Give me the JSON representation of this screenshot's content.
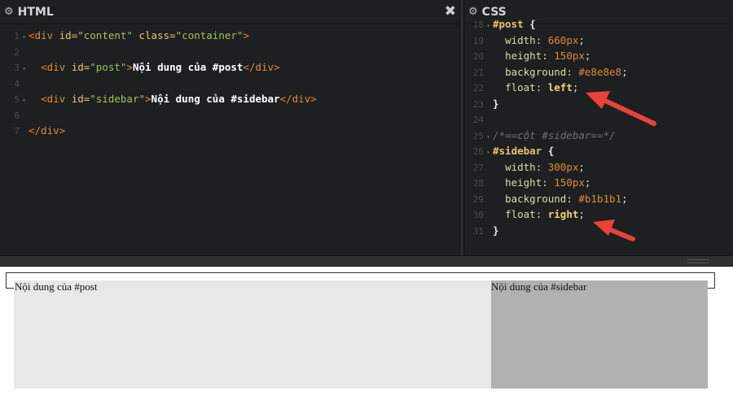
{
  "html_panel": {
    "title": "HTML",
    "settings_icon": "gear-icon",
    "close_icon": "close-icon",
    "lines": [
      {
        "n": "1",
        "fold": true,
        "parts": [
          [
            "tag",
            "<div "
          ],
          [
            "attr",
            "id="
          ],
          [
            "str",
            "\"content\""
          ],
          [
            "attr",
            " class="
          ],
          [
            "str",
            "\"container\""
          ],
          [
            "tag",
            ">"
          ]
        ]
      },
      {
        "n": "2",
        "fold": false,
        "parts": []
      },
      {
        "n": "3",
        "fold": true,
        "parts": [
          [
            "plain",
            "  "
          ],
          [
            "tag",
            "<div "
          ],
          [
            "attr",
            "id="
          ],
          [
            "str",
            "\"post\""
          ],
          [
            "tag",
            ">"
          ],
          [
            "txt",
            "Nội dung của #post"
          ],
          [
            "tag",
            "</div>"
          ]
        ]
      },
      {
        "n": "4",
        "fold": false,
        "parts": []
      },
      {
        "n": "5",
        "fold": true,
        "parts": [
          [
            "plain",
            "  "
          ],
          [
            "tag",
            "<div "
          ],
          [
            "attr",
            "id="
          ],
          [
            "str",
            "\"sidebar\""
          ],
          [
            "tag",
            ">"
          ],
          [
            "txt",
            "Nội dung của #sidebar"
          ],
          [
            "tag",
            "</div>"
          ]
        ]
      },
      {
        "n": "6",
        "fold": false,
        "parts": []
      },
      {
        "n": "7",
        "fold": false,
        "parts": [
          [
            "tag",
            "</div>"
          ]
        ]
      }
    ]
  },
  "css_panel": {
    "title": "CSS",
    "settings_icon": "gear-icon",
    "lines": [
      {
        "n": "18",
        "fold": true,
        "parts": [
          [
            "sel",
            "#post "
          ],
          [
            "brace",
            "{"
          ]
        ]
      },
      {
        "n": "19",
        "fold": false,
        "parts": [
          [
            "plain",
            "  "
          ],
          [
            "prop",
            "width: "
          ],
          [
            "num",
            "660px"
          ],
          [
            "plain",
            ";"
          ]
        ]
      },
      {
        "n": "20",
        "fold": false,
        "parts": [
          [
            "plain",
            "  "
          ],
          [
            "prop",
            "height: "
          ],
          [
            "num",
            "150px"
          ],
          [
            "plain",
            ";"
          ]
        ]
      },
      {
        "n": "21",
        "fold": false,
        "parts": [
          [
            "plain",
            "  "
          ],
          [
            "prop",
            "background: "
          ],
          [
            "num",
            "#e8e8e8"
          ],
          [
            "plain",
            ";"
          ]
        ]
      },
      {
        "n": "22",
        "fold": false,
        "parts": [
          [
            "plain",
            "  "
          ],
          [
            "prop",
            "float: "
          ],
          [
            "val",
            "left"
          ],
          [
            "plain",
            ";"
          ]
        ]
      },
      {
        "n": "23",
        "fold": false,
        "parts": [
          [
            "brace",
            "}"
          ]
        ]
      },
      {
        "n": "24",
        "fold": false,
        "parts": []
      },
      {
        "n": "25",
        "fold": true,
        "parts": [
          [
            "cmt",
            "/*==cột #sidebar==*/"
          ]
        ]
      },
      {
        "n": "26",
        "fold": true,
        "parts": [
          [
            "sel",
            "#sidebar "
          ],
          [
            "brace",
            "{"
          ]
        ]
      },
      {
        "n": "27",
        "fold": false,
        "parts": [
          [
            "plain",
            "  "
          ],
          [
            "prop",
            "width: "
          ],
          [
            "num",
            "300px"
          ],
          [
            "plain",
            ";"
          ]
        ]
      },
      {
        "n": "28",
        "fold": false,
        "parts": [
          [
            "plain",
            "  "
          ],
          [
            "prop",
            "height: "
          ],
          [
            "num",
            "150px"
          ],
          [
            "plain",
            ";"
          ]
        ]
      },
      {
        "n": "29",
        "fold": false,
        "parts": [
          [
            "plain",
            "  "
          ],
          [
            "prop",
            "background: "
          ],
          [
            "num",
            "#b1b1b1"
          ],
          [
            "plain",
            ";"
          ]
        ]
      },
      {
        "n": "30",
        "fold": false,
        "parts": [
          [
            "plain",
            "  "
          ],
          [
            "prop",
            "float: "
          ],
          [
            "val",
            "right"
          ],
          [
            "plain",
            ";"
          ]
        ]
      },
      {
        "n": "31",
        "fold": false,
        "parts": [
          [
            "brace",
            "}"
          ]
        ]
      }
    ]
  },
  "preview": {
    "post_text": "Nội dung của #post",
    "sidebar_text": "Nội dung của #sidebar",
    "post_color": "#e8e8e8",
    "sidebar_color": "#b1b1b1"
  },
  "annotation": {
    "arrow_color": "#e8423a"
  }
}
